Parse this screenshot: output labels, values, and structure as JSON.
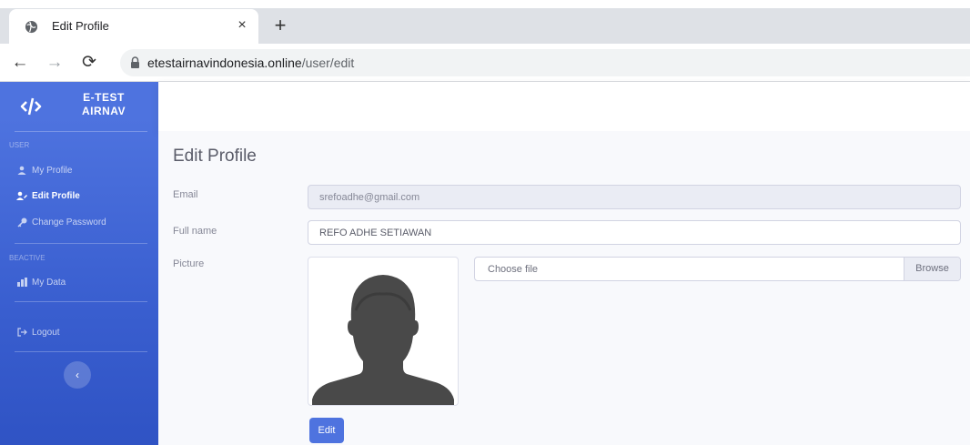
{
  "browser": {
    "tab_title": "Edit Profile",
    "close_symbol": "×",
    "newtab_symbol": "+",
    "url_host": "etestairnavindonesia.online",
    "url_path": "/user/edit"
  },
  "sidebar": {
    "brand_line1": "E-TEST",
    "brand_line2": "AIRNAV",
    "heading_user": "USER",
    "heading_beactive": "BEACTIVE",
    "items": [
      {
        "label": "My Profile",
        "icon": "user-icon",
        "active": false
      },
      {
        "label": "Edit Profile",
        "icon": "user-edit-icon",
        "active": true
      },
      {
        "label": "Change Password",
        "icon": "key-icon",
        "active": false
      },
      {
        "label": "My Data",
        "icon": "data-icon",
        "active": false
      },
      {
        "label": "Logout",
        "icon": "logout-icon",
        "active": false
      }
    ],
    "toggle_symbol": "‹"
  },
  "page": {
    "title": "Edit Profile",
    "email_label": "Email",
    "email_value": "srefoadhe@gmail.com",
    "fullname_label": "Full name",
    "fullname_value": "REFO ADHE SETIAWAN",
    "picture_label": "Picture",
    "file_placeholder": "Choose file",
    "browse_label": "Browse",
    "edit_button": "Edit"
  },
  "colors": {
    "primary": "#4e73df",
    "sidebar_dark": "#2f53c4",
    "page_bg": "#f8f9fc"
  }
}
